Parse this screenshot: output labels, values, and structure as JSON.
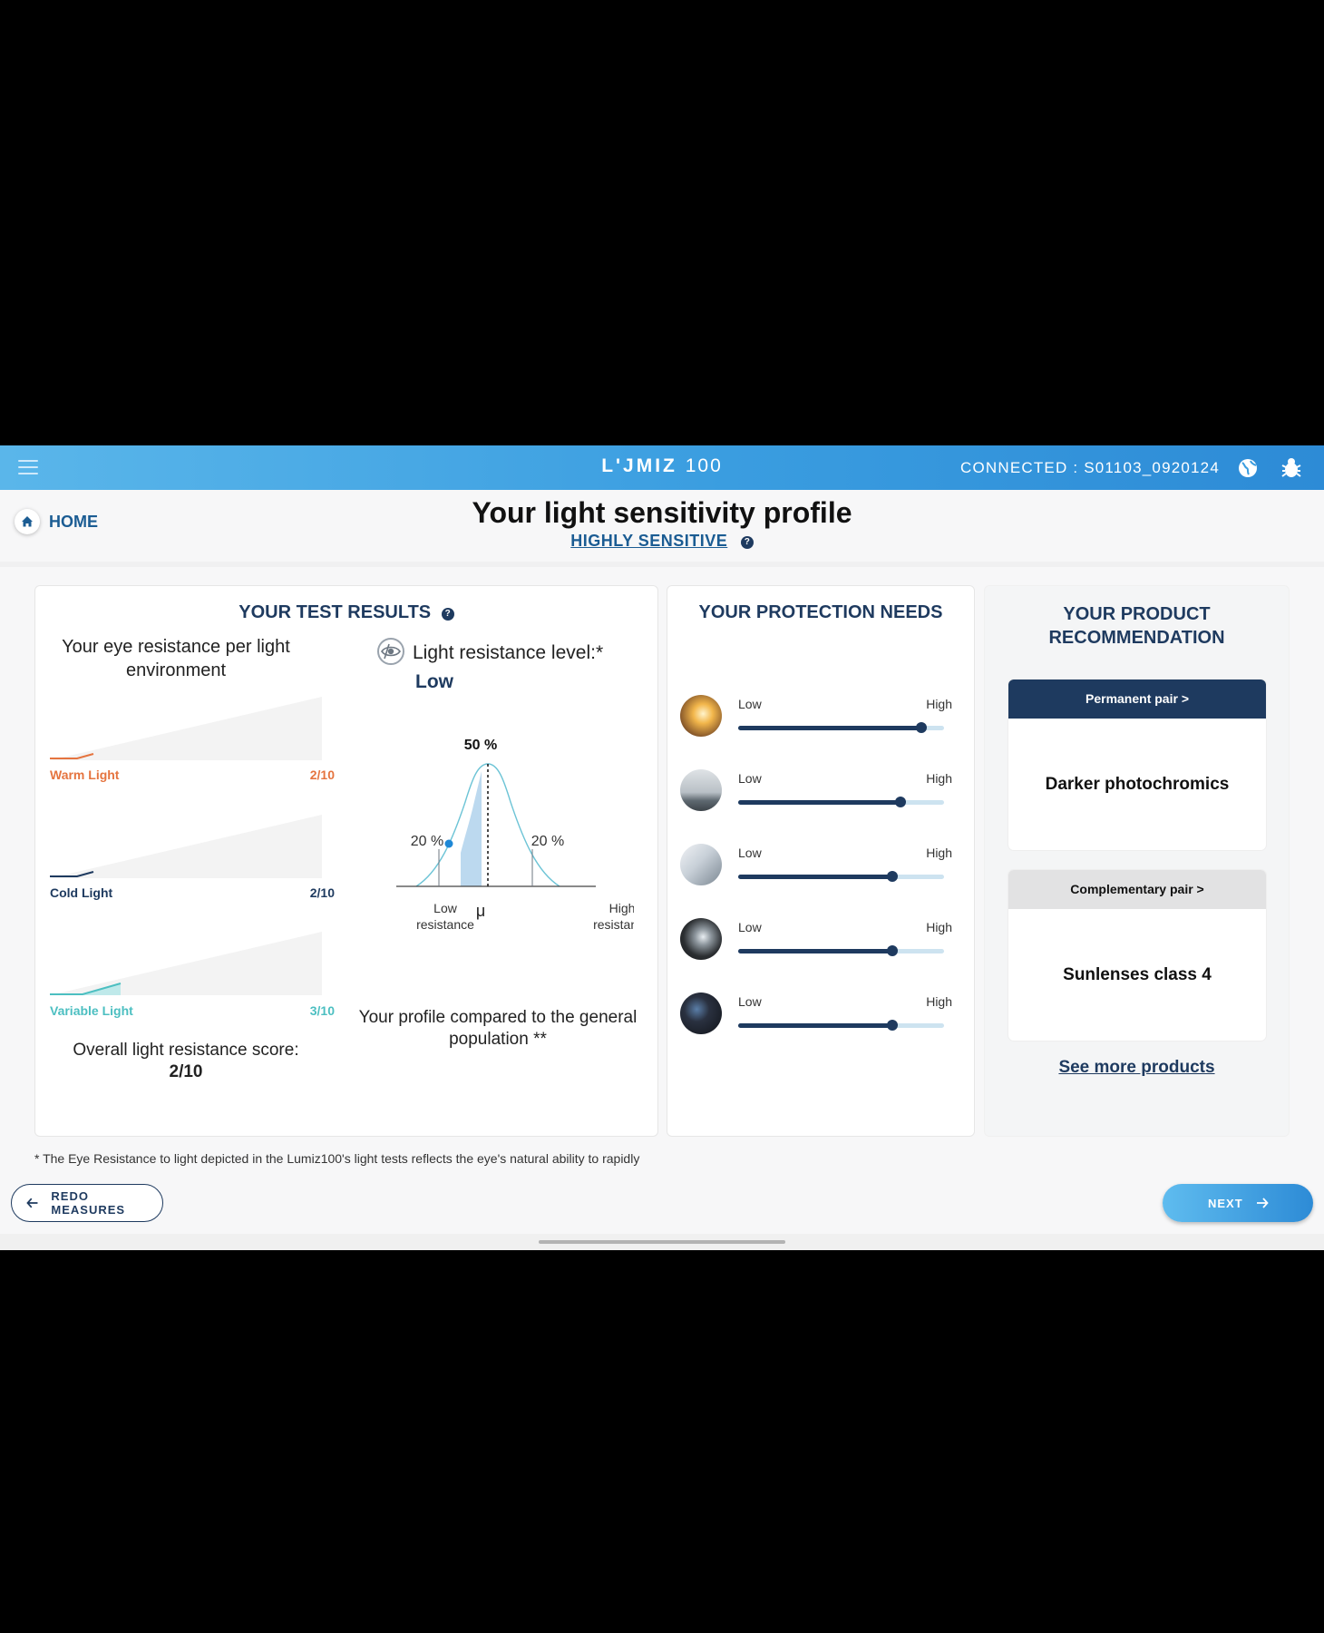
{
  "app": {
    "logo_main": "L'JMIZ",
    "logo_num": "100",
    "connected": "CONNECTED : S01103_0920124"
  },
  "header": {
    "home_label": "HOME",
    "title": "Your light sensitivity profile",
    "profile": "HIGHLY SENSITIVE",
    "help": "?"
  },
  "test_results": {
    "title": "YOUR TEST RESULTS",
    "per_env_title": "Your eye resistance per light environment",
    "environments": [
      {
        "label": "Warm Light",
        "score": "2/10",
        "value": 2,
        "color": "#e5743f"
      },
      {
        "label": "Cold Light",
        "score": "2/10",
        "value": 2,
        "color": "#1e3a5f"
      },
      {
        "label": "Variable Light",
        "score": "3/10",
        "value": 3,
        "color": "#4cbfc1"
      }
    ],
    "overall_label": "Overall light resistance score:",
    "overall_value": "2/10",
    "resistance_title": "Light resistance level:*",
    "resistance_value": "Low",
    "bell": {
      "top_label": "50 %",
      "left_label": "20 %",
      "right_label": "20 %",
      "low_label_1": "Low",
      "low_label_2": "resistance",
      "high_label_1": "High",
      "high_label_2": "resistance",
      "mu": "μ"
    },
    "compare_label": "Your profile compared to the general population **"
  },
  "protection": {
    "title": "YOUR PROTECTION NEEDS",
    "rows": [
      {
        "icon": "sunset-scene-icon",
        "low": "Low",
        "high": "High",
        "level": 0.89
      },
      {
        "icon": "overcast-scene-icon",
        "low": "Low",
        "high": "High",
        "level": 0.79
      },
      {
        "icon": "indoor-scene-icon",
        "low": "Low",
        "high": "High",
        "level": 0.75
      },
      {
        "icon": "screen-scene-icon",
        "low": "Low",
        "high": "High",
        "level": 0.75
      },
      {
        "icon": "night-city-icon",
        "low": "Low",
        "high": "High",
        "level": 0.75
      }
    ]
  },
  "recommendation": {
    "title_1": "YOUR PRODUCT",
    "title_2": "RECOMMENDATION",
    "permanent_head": "Permanent pair >",
    "permanent_product": "Darker photochromics",
    "complementary_head": "Complementary pair >",
    "complementary_product": "Sunlenses class 4",
    "see_more": "See more products"
  },
  "footnote": "* The Eye Resistance to light depicted in the Lumiz100's light tests reflects the eye's natural ability to rapidly",
  "buttons": {
    "redo": "REDO MEASURES",
    "next": "NEXT"
  },
  "colors": {
    "accent": "#1e3a5f",
    "topbar": "#3a9de0",
    "link": "#1b5c93"
  }
}
